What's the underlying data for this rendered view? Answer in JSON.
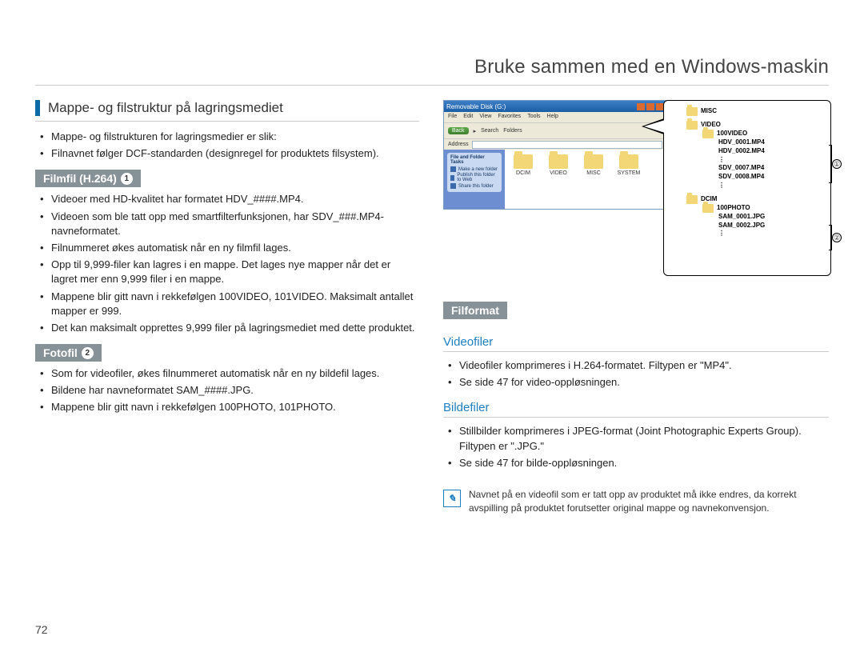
{
  "doc_title": "Bruke sammen med en Windows-maskin",
  "page_number": "72",
  "left": {
    "section_heading": "Mappe- og filstruktur på lagringsmediet",
    "intro_bullets": [
      "Mappe- og filstrukturen for lagringsmedier er slik:",
      "Filnavnet følger DCF-standarden (designregel for produktets filsystem)."
    ],
    "tag1": {
      "label": "Filmfil (H.264)",
      "num": "1"
    },
    "bullets1": [
      "Videoer med HD-kvalitet har formatet HDV_####.MP4.",
      "Videoen som ble tatt opp med smartfilterfunksjonen, har SDV_###.MP4-navneformatet.",
      "Filnummeret økes automatisk når en ny filmfil lages.",
      "Opp til 9,999-filer kan lagres i en mappe. Det lages nye mapper når det er lagret mer enn 9,999 filer i en mappe.",
      "Mappene blir gitt navn i rekkefølgen 100VIDEO, 101VIDEO. Maksimalt antallet mapper er 999.",
      "Det kan maksimalt opprettes 9,999 filer på lagringsmediet med dette produktet."
    ],
    "tag2": {
      "label": "Fotofil",
      "num": "2"
    },
    "bullets2": [
      "Som for videofiler, økes filnummeret automatisk når en ny bildefil lages.",
      "Bildene har navneformatet SAM_####.JPG.",
      "Mappene blir gitt navn i rekkefølgen 100PHOTO, 101PHOTO."
    ]
  },
  "right": {
    "tag_filformat": "Filformat",
    "sub_video": "Videofiler",
    "bullets_video": [
      "Videofiler komprimeres i H.264-formatet. Filtypen er \"MP4\".",
      "Se side 47 for video-oppløsningen."
    ],
    "sub_image": "Bildefiler",
    "bullets_image": [
      "Stillbilder komprimeres i JPEG-format (Joint Photographic Experts Group). Filtypen er \".JPG.\"",
      "Se side 47 for bilde-oppløsningen."
    ],
    "note_text": "Navnet på en videofil som er tatt opp av produktet må ikke endres, da korrekt avspilling på produktet forutsetter original mappe og navnekonvensjon."
  },
  "screenshot": {
    "title": "Removable Disk (G:)",
    "menu": [
      "File",
      "Edit",
      "View",
      "Favorites",
      "Tools",
      "Help"
    ],
    "back": "Back",
    "search": "Search",
    "folders_btn": "Folders",
    "address_label": "Address",
    "side_panel_header": "File and Folder Tasks",
    "side_items": [
      "Make a new folder",
      "Publish this folder to Web",
      "Share this folder"
    ],
    "folders": [
      "DCIM",
      "VIDEO",
      "MISC",
      "SYSTEM"
    ]
  },
  "tree": {
    "n1": "MISC",
    "n2": "VIDEO",
    "n3": "100VIDEO",
    "f1": "HDV_0001.MP4",
    "f2": "HDV_0002.MP4",
    "f3": "SDV_0007.MP4",
    "f4": "SDV_0008.MP4",
    "n4": "DCIM",
    "n5": "100PHOTO",
    "f5": "SAM_0001.JPG",
    "f6": "SAM_0002.JPG",
    "brace1": "①",
    "brace2": "②"
  }
}
